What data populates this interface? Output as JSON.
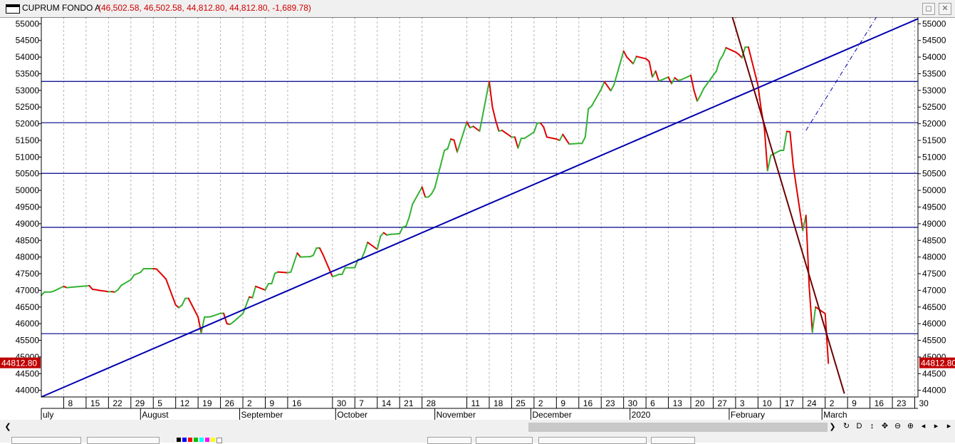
{
  "window": {
    "title": "CUPRUM FONDO A",
    "values_text": "(46,502.58, 46,502.58, 44,812.80, 44,812.80, -1,689.78)",
    "restore_icon": "restore-icon",
    "close_icon": "close-icon"
  },
  "colors": {
    "up": "#33b233",
    "down": "#e00000",
    "support_resistance": "#00008b",
    "trendline_up": "#0000b0",
    "trendline_down": "#6b0000",
    "grid": "#b4b4b4",
    "price_tag_bg": "#c00000",
    "price_tag_text": "#ffffff"
  },
  "chart_data": {
    "type": "line",
    "title": "CUPRUM FONDO A",
    "ohlc_change": [
      46502.58,
      46502.58,
      44812.8,
      44812.8,
      -1689.78
    ],
    "last_price": 44812.8,
    "last_price_label": "44812.80",
    "ylim": [
      43800,
      55200
    ],
    "y_ticks": [
      44000,
      44500,
      45000,
      45500,
      46000,
      46500,
      47000,
      47500,
      48000,
      48500,
      49000,
      49500,
      50000,
      50500,
      51000,
      51500,
      52000,
      52500,
      53000,
      53500,
      54000,
      54500,
      55000
    ],
    "x_range": [
      "2019-07-01",
      "2020-03-31"
    ],
    "y_axis_sides": [
      "left",
      "right"
    ],
    "grid": "vertical dotted at each week",
    "day_ticks": [
      {
        "date": "2019-07-08",
        "label": "8"
      },
      {
        "date": "2019-07-15",
        "label": "15"
      },
      {
        "date": "2019-07-22",
        "label": "22"
      },
      {
        "date": "2019-07-29",
        "label": "29"
      },
      {
        "date": "2019-08-05",
        "label": "5"
      },
      {
        "date": "2019-08-12",
        "label": "12"
      },
      {
        "date": "2019-08-19",
        "label": "19"
      },
      {
        "date": "2019-08-26",
        "label": "26"
      },
      {
        "date": "2019-09-02",
        "label": "2"
      },
      {
        "date": "2019-09-09",
        "label": "9"
      },
      {
        "date": "2019-09-16",
        "label": "16"
      },
      {
        "date": "2019-09-30",
        "label": "30"
      },
      {
        "date": "2019-10-07",
        "label": "7"
      },
      {
        "date": "2019-10-14",
        "label": "14"
      },
      {
        "date": "2019-10-21",
        "label": "21"
      },
      {
        "date": "2019-10-28",
        "label": "28"
      },
      {
        "date": "2019-11-11",
        "label": "11"
      },
      {
        "date": "2019-11-18",
        "label": "18"
      },
      {
        "date": "2019-11-25",
        "label": "25"
      },
      {
        "date": "2019-12-02",
        "label": "2"
      },
      {
        "date": "2019-12-09",
        "label": "9"
      },
      {
        "date": "2019-12-16",
        "label": "16"
      },
      {
        "date": "2019-12-23",
        "label": "23"
      },
      {
        "date": "2019-12-30",
        "label": "30"
      },
      {
        "date": "2020-01-06",
        "label": "6"
      },
      {
        "date": "2020-01-13",
        "label": "13"
      },
      {
        "date": "2020-01-20",
        "label": "20"
      },
      {
        "date": "2020-01-27",
        "label": "27"
      },
      {
        "date": "2020-02-03",
        "label": "3"
      },
      {
        "date": "2020-02-10",
        "label": "10"
      },
      {
        "date": "2020-02-17",
        "label": "17"
      },
      {
        "date": "2020-02-24",
        "label": "24"
      },
      {
        "date": "2020-03-02",
        "label": "2"
      },
      {
        "date": "2020-03-09",
        "label": "9"
      },
      {
        "date": "2020-03-16",
        "label": "16"
      },
      {
        "date": "2020-03-23",
        "label": "23"
      },
      {
        "date": "2020-03-30",
        "label": "30"
      }
    ],
    "month_ticks": [
      {
        "date": "2019-07-01",
        "label": "uly"
      },
      {
        "date": "2019-08-01",
        "label": "August"
      },
      {
        "date": "2019-09-01",
        "label": "September"
      },
      {
        "date": "2019-10-01",
        "label": "October"
      },
      {
        "date": "2019-11-01",
        "label": "November"
      },
      {
        "date": "2019-12-01",
        "label": "December"
      },
      {
        "date": "2020-01-01",
        "label": "2020"
      },
      {
        "date": "2020-02-01",
        "label": "February"
      },
      {
        "date": "2020-03-01",
        "label": "March"
      }
    ],
    "series": [
      {
        "values": [
          [
            "2019-07-01",
            46850
          ],
          [
            "2019-07-02",
            46950
          ],
          [
            "2019-07-04",
            46950
          ],
          [
            "2019-07-05",
            46980
          ],
          [
            "2019-07-08",
            47120
          ],
          [
            "2019-07-09",
            47080
          ],
          [
            "2019-07-11",
            47100
          ],
          [
            "2019-07-15",
            47130
          ],
          [
            "2019-07-16",
            47140
          ],
          [
            "2019-07-17",
            47030
          ],
          [
            "2019-07-18",
            47020
          ],
          [
            "2019-07-19",
            47000
          ],
          [
            "2019-07-22",
            46960
          ],
          [
            "2019-07-23",
            46960
          ],
          [
            "2019-07-24",
            46950
          ],
          [
            "2019-07-25",
            47020
          ],
          [
            "2019-07-26",
            47150
          ],
          [
            "2019-07-29",
            47320
          ],
          [
            "2019-07-30",
            47460
          ],
          [
            "2019-07-31",
            47500
          ],
          [
            "2019-08-01",
            47540
          ],
          [
            "2019-08-02",
            47650
          ],
          [
            "2019-08-05",
            47650
          ],
          [
            "2019-08-06",
            47640
          ],
          [
            "2019-08-08",
            47440
          ],
          [
            "2019-08-09",
            47330
          ],
          [
            "2019-08-12",
            46560
          ],
          [
            "2019-08-13",
            46480
          ],
          [
            "2019-08-14",
            46560
          ],
          [
            "2019-08-15",
            46760
          ],
          [
            "2019-08-16",
            46760
          ],
          [
            "2019-08-19",
            46200
          ],
          [
            "2019-08-20",
            45720
          ],
          [
            "2019-08-21",
            46200
          ],
          [
            "2019-08-22",
            46200
          ],
          [
            "2019-08-23",
            46210
          ],
          [
            "2019-08-26",
            46310
          ],
          [
            "2019-08-27",
            46310
          ],
          [
            "2019-08-28",
            46000
          ],
          [
            "2019-08-29",
            45980
          ],
          [
            "2019-08-30",
            46050
          ],
          [
            "2019-09-02",
            46300
          ],
          [
            "2019-09-03",
            46550
          ],
          [
            "2019-09-04",
            46800
          ],
          [
            "2019-09-05",
            46780
          ],
          [
            "2019-09-06",
            47120
          ],
          [
            "2019-09-09",
            47010
          ],
          [
            "2019-09-10",
            47200
          ],
          [
            "2019-09-11",
            47200
          ],
          [
            "2019-09-12",
            47510
          ],
          [
            "2019-09-13",
            47550
          ],
          [
            "2019-09-16",
            47530
          ],
          [
            "2019-09-17",
            47550
          ],
          [
            "2019-09-19",
            48120
          ],
          [
            "2019-09-20",
            48000
          ],
          [
            "2019-09-23",
            48010
          ],
          [
            "2019-09-24",
            48050
          ],
          [
            "2019-09-25",
            48270
          ],
          [
            "2019-09-26",
            48270
          ],
          [
            "2019-09-27",
            48080
          ],
          [
            "2019-09-30",
            47410
          ],
          [
            "2019-10-01",
            47440
          ],
          [
            "2019-10-02",
            47480
          ],
          [
            "2019-10-03",
            47480
          ],
          [
            "2019-10-04",
            47680
          ],
          [
            "2019-10-07",
            47680
          ],
          [
            "2019-10-08",
            47930
          ],
          [
            "2019-10-09",
            47930
          ],
          [
            "2019-10-10",
            48150
          ],
          [
            "2019-10-11",
            48440
          ],
          [
            "2019-10-14",
            48230
          ],
          [
            "2019-10-15",
            48620
          ],
          [
            "2019-10-16",
            48730
          ],
          [
            "2019-10-17",
            48660
          ],
          [
            "2019-10-18",
            48680
          ],
          [
            "2019-10-21",
            48700
          ],
          [
            "2019-10-22",
            48900
          ],
          [
            "2019-10-23",
            48930
          ],
          [
            "2019-10-24",
            49200
          ],
          [
            "2019-10-25",
            49580
          ],
          [
            "2019-10-28",
            50100
          ],
          [
            "2019-10-29",
            49800
          ],
          [
            "2019-10-30",
            49800
          ],
          [
            "2019-10-31",
            49900
          ],
          [
            "2019-11-01",
            50080
          ],
          [
            "2019-11-04",
            51200
          ],
          [
            "2019-11-05",
            51250
          ],
          [
            "2019-11-06",
            51540
          ],
          [
            "2019-11-07",
            51510
          ],
          [
            "2019-11-08",
            51150
          ],
          [
            "2019-11-11",
            52050
          ],
          [
            "2019-11-12",
            51880
          ],
          [
            "2019-11-13",
            51920
          ],
          [
            "2019-11-14",
            51850
          ],
          [
            "2019-11-15",
            51780
          ],
          [
            "2019-11-18",
            53270
          ],
          [
            "2019-11-19",
            52500
          ],
          [
            "2019-11-20",
            52100
          ],
          [
            "2019-11-21",
            51780
          ],
          [
            "2019-11-22",
            51800
          ],
          [
            "2019-11-25",
            51600
          ],
          [
            "2019-11-26",
            51600
          ],
          [
            "2019-11-27",
            51270
          ],
          [
            "2019-11-28",
            51560
          ],
          [
            "2019-11-29",
            51560
          ],
          [
            "2019-12-02",
            51750
          ],
          [
            "2019-12-03",
            52020
          ],
          [
            "2019-12-04",
            52020
          ],
          [
            "2019-12-05",
            51900
          ],
          [
            "2019-12-06",
            51600
          ],
          [
            "2019-12-09",
            51540
          ],
          [
            "2019-12-10",
            51500
          ],
          [
            "2019-12-11",
            51680
          ],
          [
            "2019-12-12",
            51530
          ],
          [
            "2019-12-13",
            51390
          ],
          [
            "2019-12-16",
            51410
          ],
          [
            "2019-12-17",
            51410
          ],
          [
            "2019-12-18",
            51600
          ],
          [
            "2019-12-19",
            52450
          ],
          [
            "2019-12-20",
            52530
          ],
          [
            "2019-12-23",
            53040
          ],
          [
            "2019-12-24",
            53260
          ],
          [
            "2019-12-26",
            52990
          ],
          [
            "2019-12-27",
            53170
          ],
          [
            "2019-12-30",
            54180
          ],
          [
            "2019-12-31",
            54000
          ],
          [
            "2020-01-02",
            53800
          ],
          [
            "2020-01-03",
            54020
          ],
          [
            "2020-01-06",
            53950
          ],
          [
            "2020-01-07",
            53870
          ],
          [
            "2020-01-08",
            53400
          ],
          [
            "2020-01-09",
            53580
          ],
          [
            "2020-01-10",
            53280
          ],
          [
            "2020-01-13",
            53400
          ],
          [
            "2020-01-14",
            53200
          ],
          [
            "2020-01-15",
            53380
          ],
          [
            "2020-01-16",
            53300
          ],
          [
            "2020-01-17",
            53320
          ],
          [
            "2020-01-20",
            53450
          ],
          [
            "2020-01-21",
            53000
          ],
          [
            "2020-01-22",
            52680
          ],
          [
            "2020-01-23",
            52850
          ],
          [
            "2020-01-24",
            53050
          ],
          [
            "2020-01-27",
            53450
          ],
          [
            "2020-01-28",
            53580
          ],
          [
            "2020-01-29",
            53900
          ],
          [
            "2020-01-30",
            54050
          ],
          [
            "2020-01-31",
            54280
          ],
          [
            "2020-02-03",
            54150
          ],
          [
            "2020-02-04",
            54080
          ],
          [
            "2020-02-05",
            53980
          ],
          [
            "2020-02-06",
            54300
          ],
          [
            "2020-02-07",
            54300
          ],
          [
            "2020-02-10",
            53150
          ],
          [
            "2020-02-11",
            52430
          ],
          [
            "2020-02-12",
            51870
          ],
          [
            "2020-02-13",
            50590
          ],
          [
            "2020-02-14",
            51050
          ],
          [
            "2020-02-17",
            51200
          ],
          [
            "2020-02-18",
            51200
          ],
          [
            "2020-02-19",
            51770
          ],
          [
            "2020-02-20",
            51760
          ],
          [
            "2020-02-21",
            50750
          ],
          [
            "2020-02-24",
            48800
          ],
          [
            "2020-02-25",
            49250
          ],
          [
            "2020-02-26",
            47120
          ],
          [
            "2020-02-27",
            45750
          ],
          [
            "2020-02-28",
            46500
          ],
          [
            "2020-03-02",
            46300
          ],
          [
            "2020-03-03",
            44812.8
          ]
        ]
      }
    ],
    "horizontal_lines": [
      53270,
      52030,
      50510,
      48890,
      45700
    ],
    "trendlines": [
      {
        "name": "uptrend",
        "from": [
          "2019-07-01",
          43800
        ],
        "to": [
          "2020-03-31",
          55150
        ]
      },
      {
        "name": "downtrend",
        "from": [
          "2020-02-02",
          55200
        ],
        "to": [
          "2020-03-08",
          43900
        ]
      },
      {
        "name": "uptrend-projection",
        "from": [
          "2020-02-25",
          51800
        ],
        "to": [
          "2020-03-18",
          55200
        ]
      }
    ]
  }
}
